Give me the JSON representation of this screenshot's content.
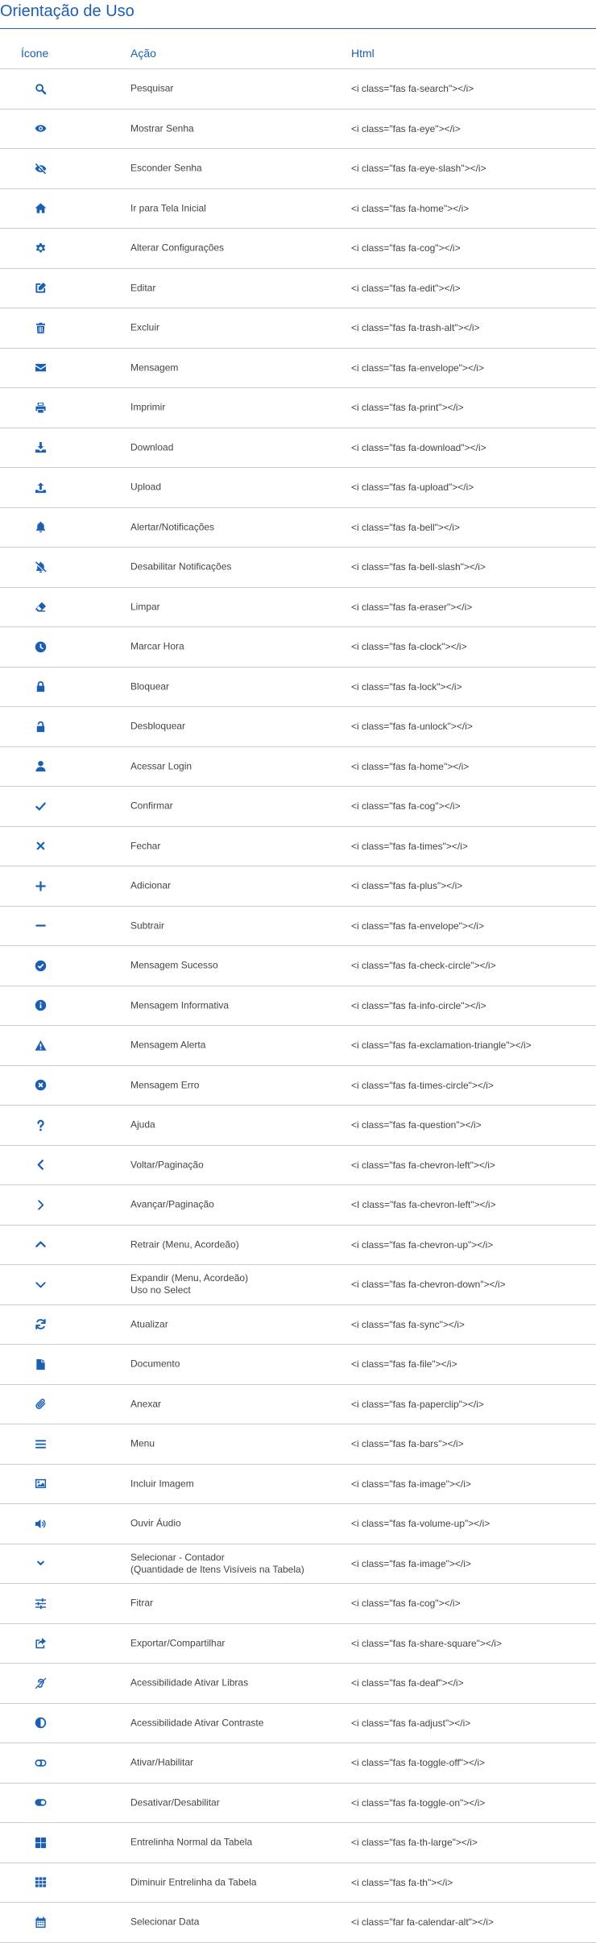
{
  "page_title": "Orientação de Uso",
  "columns": [
    "Ícone",
    "Ação",
    "Html"
  ],
  "accent_color": "#1a5fb4",
  "rows": [
    {
      "icon": "search-icon",
      "action": "Pesquisar",
      "html": "<i class=\"fas fa-search\"></i>"
    },
    {
      "icon": "eye-icon",
      "action": "Mostrar Senha",
      "html": "<i class=\"fas fa-eye\"></i>"
    },
    {
      "icon": "eye-slash-icon",
      "action": "Esconder Senha",
      "html": "<i class=\"fas fa-eye-slash\"></i>"
    },
    {
      "icon": "home-icon",
      "action": "Ir para Tela Inicial",
      "html": "<i class=\"fas fa-home\"></i>"
    },
    {
      "icon": "cog-icon",
      "action": "Alterar Configurações",
      "html": "<i class=\"fas fa-cog\"></i>"
    },
    {
      "icon": "edit-icon",
      "action": "Editar",
      "html": "<i class=\"fas fa-edit\"></i>"
    },
    {
      "icon": "trash-icon",
      "action": "Excluir",
      "html": "<i class=\"fas fa-trash-alt\"></i>"
    },
    {
      "icon": "envelope-icon",
      "action": "Mensagem",
      "html": "<i class=\"fas fa-envelope\"></i>"
    },
    {
      "icon": "print-icon",
      "action": "Imprimir",
      "html": "<i class=\"fas fa-print\"></i>"
    },
    {
      "icon": "download-icon",
      "action": "Download",
      "html": "<i class=\"fas fa-download\"></i>"
    },
    {
      "icon": "upload-icon",
      "action": "Upload",
      "html": "<i class=\"fas fa-upload\"></i>"
    },
    {
      "icon": "bell-icon",
      "action": "Alertar/Notificações",
      "html": "<i class=\"fas fa-bell\"></i>"
    },
    {
      "icon": "bell-slash-icon",
      "action": "Desabilitar Notificações",
      "html": "<i class=\"fas fa-bell-slash\"></i>"
    },
    {
      "icon": "eraser-icon",
      "action": "Limpar",
      "html": "<i class=\"fas fa-eraser\"></i>"
    },
    {
      "icon": "clock-icon",
      "action": "Marcar Hora",
      "html": "<i class=\"fas fa-clock\"></i>"
    },
    {
      "icon": "lock-icon",
      "action": "Bloquear",
      "html": "<i class=\"fas fa-lock\"></i>"
    },
    {
      "icon": "unlock-icon",
      "action": "Desbloquear",
      "html": "<i class=\"fas fa-unlock\"></i>"
    },
    {
      "icon": "user-icon",
      "action": "Acessar Login",
      "html": "<i class=\"fas fa-home\"></i>"
    },
    {
      "icon": "check-icon",
      "action": "Confirmar",
      "html": "<i class=\"fas fa-cog\"></i>"
    },
    {
      "icon": "times-icon",
      "action": "Fechar",
      "html": "<i class=\"fas fa-times\"></i>"
    },
    {
      "icon": "plus-icon",
      "action": "Adicionar",
      "html": "<i class=\"fas fa-plus\"></i>"
    },
    {
      "icon": "minus-icon",
      "action": "Subtrair",
      "html": "<i class=\"fas fa-envelope\"></i>"
    },
    {
      "icon": "check-circle-icon",
      "action": "Mensagem Sucesso",
      "html": "<i class=\"fas fa-check-circle\"></i>"
    },
    {
      "icon": "info-circle-icon",
      "action": "Mensagem Informativa",
      "html": "<i class=\"fas fa-info-circle\"></i>"
    },
    {
      "icon": "exclamation-triangle-icon",
      "action": "Mensagem Alerta",
      "html": "<i class=\"fas fa-exclamation-triangle\"></i>"
    },
    {
      "icon": "times-circle-icon",
      "action": "Mensagem Erro",
      "html": "<i class=\"fas fa-times-circle\"></i>"
    },
    {
      "icon": "question-icon",
      "action": "Ajuda",
      "html": "<i class=\"fas fa-question\"></i>"
    },
    {
      "icon": "chevron-left-icon",
      "action": "Voltar/Paginação",
      "html": "<i class=\"fas fa-chevron-left\"></i>"
    },
    {
      "icon": "chevron-right-icon",
      "action": "Avançar/Paginação",
      "html": "<I class=\"fas fa-chevron-left\"></i>"
    },
    {
      "icon": "chevron-up-icon",
      "action": "Retrair (Menu, Acordeão)",
      "html": "<i class=\"fas fa-chevron-up\"></i>"
    },
    {
      "icon": "chevron-down-icon",
      "action": "Expandir (Menu, Acordeão)\nUso no Select",
      "html": "<i class=\"fas fa-chevron-down\"></i>"
    },
    {
      "icon": "sync-icon",
      "action": "Atualizar",
      "html": "<i class=\"fas fa-sync\"></i>"
    },
    {
      "icon": "file-icon",
      "action": "Documento",
      "html": "<i class=\"fas fa-file\"></i>"
    },
    {
      "icon": "paperclip-icon",
      "action": "Anexar",
      "html": "<i class=\"fas fa-paperclip\"></i>"
    },
    {
      "icon": "bars-icon",
      "action": "Menu",
      "html": "<i class=\"fas fa-bars\"></i>"
    },
    {
      "icon": "image-icon",
      "action": "Incluir Imagem",
      "html": "<i class=\"fas fa-image\"></i>"
    },
    {
      "icon": "volume-up-icon",
      "action": "Ouvir Áudio",
      "html": "<i class=\"fas fa-volume-up\"></i>"
    },
    {
      "icon": "chevron-down-small-icon",
      "action": "Selecionar - Contador\n(Quantidade de Itens Visíveis na Tabela)",
      "html": "<i class=\"fas fa-image\"></i>"
    },
    {
      "icon": "sliders-icon",
      "action": "Fitrar",
      "html": "<i class=\"fas fa-cog\"></i>"
    },
    {
      "icon": "share-square-icon",
      "action": "Exportar/Compartilhar",
      "html": "<i class=\"fas fa-share-square\"></i>"
    },
    {
      "icon": "deaf-icon",
      "action": "Acessibilidade Ativar Libras",
      "html": "<i class=\"fas fa-deaf\"></i>"
    },
    {
      "icon": "adjust-icon",
      "action": "Acessibilidade Ativar Contraste",
      "html": "<i class=\"fas fa-adjust\"></i>"
    },
    {
      "icon": "toggle-off-icon",
      "action": "Ativar/Habilitar",
      "html": "<i class=\"fas fa-toggle-off\"></i>"
    },
    {
      "icon": "toggle-on-icon",
      "action": "Desativar/Desabilitar",
      "html": "<i class=\"fas fa-toggle-on\"></i>"
    },
    {
      "icon": "th-large-icon",
      "action": "Entrelinha Normal da Tabela",
      "html": "<i class=\"fas fa-th-large\"></i>"
    },
    {
      "icon": "th-icon",
      "action": "Diminuir Entrelinha da Tabela",
      "html": "<i class=\"fas fa-th\"></i>"
    },
    {
      "icon": "calendar-icon",
      "action": "Selecionar Data",
      "html": "<i class=\"far fa-calendar-alt\"></i>"
    }
  ]
}
